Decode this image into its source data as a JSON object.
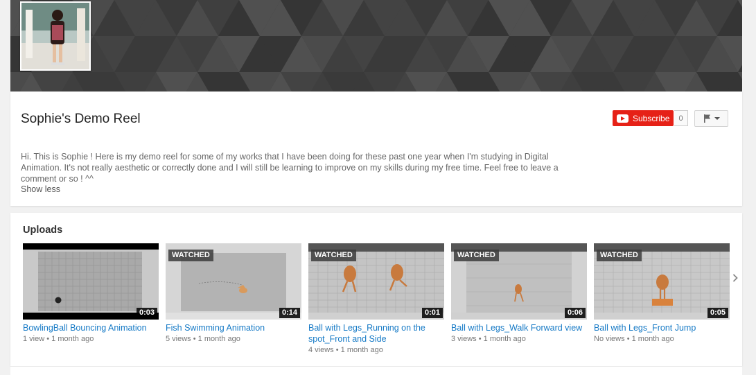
{
  "channel": {
    "title": "Sophie's Demo Reel",
    "description": "Hi. This is Sophie ! Here is my demo reel for some of my works that I have been doing for these past one year when I'm studying in Digital Animation. It's not really aesthetic or correctly done and I will still be learning to improve on my skills during my free time. Feel free to leave a comment or so ! ^^",
    "show_less_label": "Show less",
    "subscribe_label": "Subscribe",
    "subscriber_count": "0"
  },
  "uploads": {
    "title": "Uploads",
    "watched_label": "WATCHED",
    "videos": [
      {
        "title": "BowlingBall Bouncing Animation",
        "views": "1 view",
        "age": "1 month ago",
        "duration": "0:03",
        "watched": false
      },
      {
        "title": "Fish Swimming Animation",
        "views": "5 views",
        "age": "1 month ago",
        "duration": "0:14",
        "watched": true
      },
      {
        "title": "Ball with Legs_Running on the spot_Front and Side",
        "views": "4 views",
        "age": "1 month ago",
        "duration": "0:01",
        "watched": true
      },
      {
        "title": "Ball with Legs_Walk Forward view",
        "views": "3 views",
        "age": "1 month ago",
        "duration": "0:06",
        "watched": true
      },
      {
        "title": "Ball with Legs_Front Jump",
        "views": "No views",
        "age": "1 month ago",
        "duration": "0:05",
        "watched": true
      }
    ]
  },
  "colors": {
    "accent_link": "#167ac6",
    "subscribe_red": "#e62117"
  },
  "icons": {
    "subscribe": "youtube-play-icon",
    "flag": "flag-icon",
    "dropdown": "caret-down-icon",
    "next": "chevron-right-icon"
  }
}
